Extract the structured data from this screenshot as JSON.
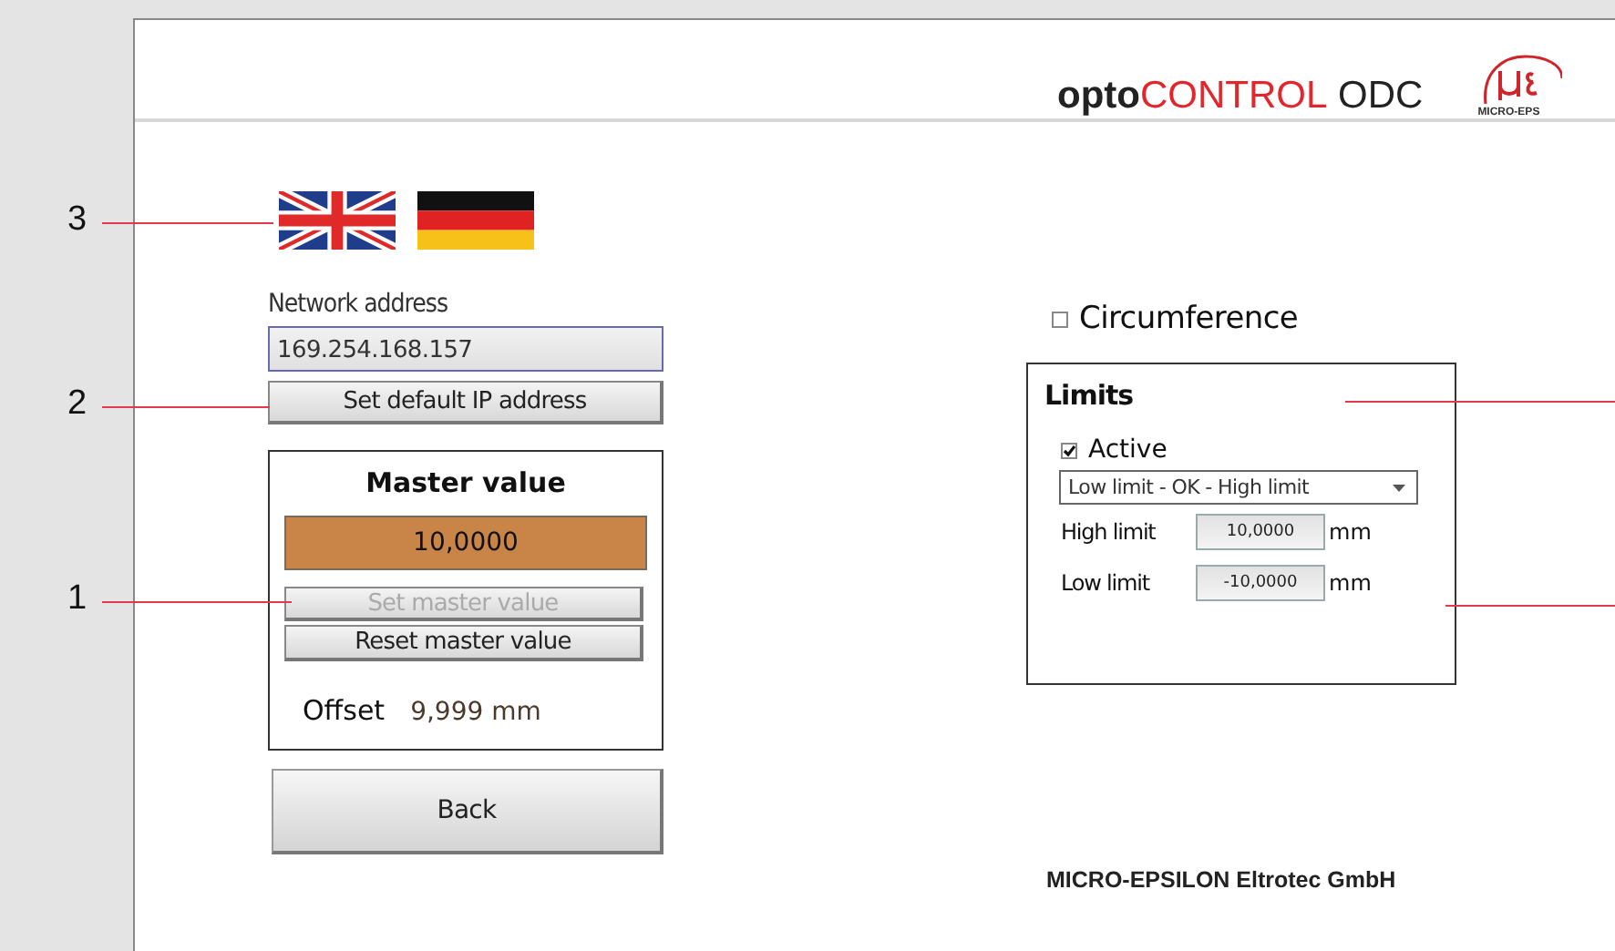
{
  "header": {
    "brand_prefix": "opto",
    "brand_highlight": "CONTROL",
    "brand_suffix": "ODC",
    "logo_caption": "MICRO-EPS"
  },
  "languages": [
    {
      "kind": "uk"
    },
    {
      "kind": "de"
    }
  ],
  "network": {
    "label": "Network address",
    "value": "169.254.168.157",
    "button": "Set default IP address"
  },
  "master": {
    "title": "Master value",
    "value": "10,0000",
    "buttons": [
      {
        "label": "Set master value",
        "disabled": true
      },
      {
        "label": "Reset master value",
        "disabled": false
      }
    ],
    "offset_label": "Offset",
    "offset_value": "9,999 mm"
  },
  "back_button": "Back",
  "circumference": {
    "label": "Circumference",
    "checked": false
  },
  "limits": {
    "title": "Limits",
    "active": {
      "label": "Active",
      "checked": true
    },
    "mode": "Low limit - OK - High limit",
    "fields": [
      {
        "label": "High limit",
        "value": "10,0000",
        "unit": "mm"
      },
      {
        "label": "Low limit",
        "value": "-10,0000",
        "unit": "mm"
      }
    ]
  },
  "footer": "MICRO-EPSILON Eltrotec GmbH",
  "callouts": [
    {
      "label": "3"
    },
    {
      "label": "2"
    },
    {
      "label": "1"
    }
  ]
}
